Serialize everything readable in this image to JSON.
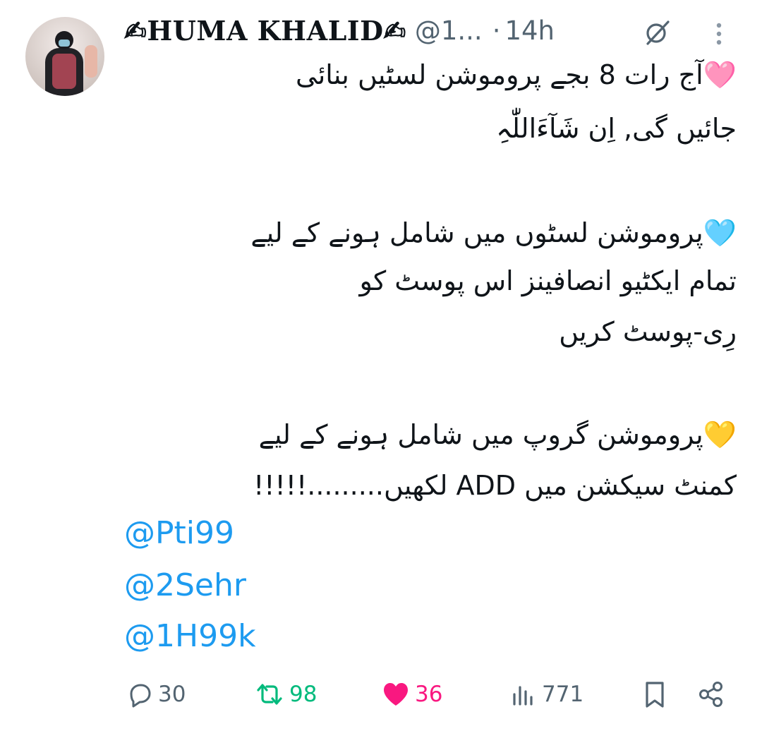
{
  "tweet": {
    "author": {
      "name": "✍︎HUMA KHALID✍︎",
      "handle": "@1...",
      "time": "14h"
    },
    "text_lines": [
      "🩷آج رات 8 بجے پروموشن لسٹیں بنائی",
      "جائیں گی, اِن شَآءَاللّٰہِ",
      "🩵پروموشن لسٹوں میں شامل ہونے کے لیے",
      "تمام ایکٹیو انصافینز اس پوسٹ کو",
      "رِی-پوسٹ کریں",
      "💛پروموشن گروپ میں شامل ہونے کے لیے",
      "کمنٹ سیکشن میں ADD لکھیں.........!!!!!"
    ],
    "mentions": [
      "@Pti99",
      "@2Sehr",
      "@1H99k"
    ],
    "stats": {
      "replies": "30",
      "reposts": "98",
      "likes": "36",
      "views": "771"
    },
    "icons": [
      "grok-icon",
      "more-icon",
      "reply-icon",
      "repost-icon",
      "like-icon",
      "views-icon",
      "bookmark-icon",
      "share-icon"
    ],
    "colors": {
      "link": "#1d9bf0",
      "repost_active": "#00ba7c",
      "like_active": "#f91880",
      "muted": "#536471"
    }
  }
}
